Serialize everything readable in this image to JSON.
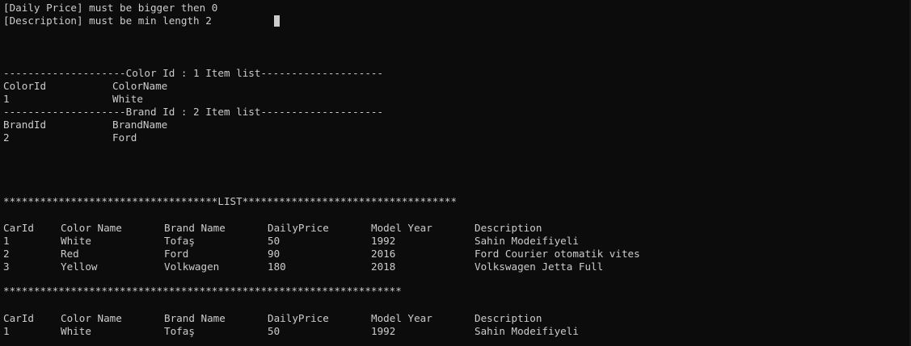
{
  "validation": {
    "messages": [
      "[Daily Price] must be bigger then 0",
      "[Description] must be min length 2"
    ]
  },
  "color_section": {
    "header": "--------------------Color Id : 1 Item list--------------------",
    "columns": [
      "ColorId",
      "ColorName"
    ],
    "rows": [
      [
        "1",
        "White"
      ]
    ]
  },
  "brand_section": {
    "header": "--------------------Brand Id : 2 Item list--------------------",
    "columns": [
      "BrandId",
      "BrandName"
    ],
    "rows": [
      [
        "2",
        "Ford"
      ]
    ]
  },
  "list_section": {
    "header": "***********************************LIST***********************************",
    "columns": [
      "CarId",
      "Color Name",
      "Brand Name",
      "DailyPrice",
      "Model Year",
      "Description"
    ],
    "rows": [
      [
        "1",
        "White",
        "Tofaş",
        "50",
        "1992",
        "Sahin Modeifiyeli"
      ],
      [
        "2",
        "Red",
        "Ford",
        "90",
        "2016",
        "Ford Courier otomatik vites"
      ],
      [
        "3",
        "Yellow",
        "Volkwagen",
        "180",
        "2018",
        "Volkswagen Jetta Full"
      ]
    ],
    "separator": "*****************************************************************"
  },
  "single_section": {
    "columns": [
      "CarId",
      "Color Name",
      "Brand Name",
      "DailyPrice",
      "Model Year",
      "Description"
    ],
    "rows": [
      [
        "1",
        "White",
        "Tofaş",
        "50",
        "1992",
        "Sahin Modeifiyeli"
      ]
    ]
  }
}
